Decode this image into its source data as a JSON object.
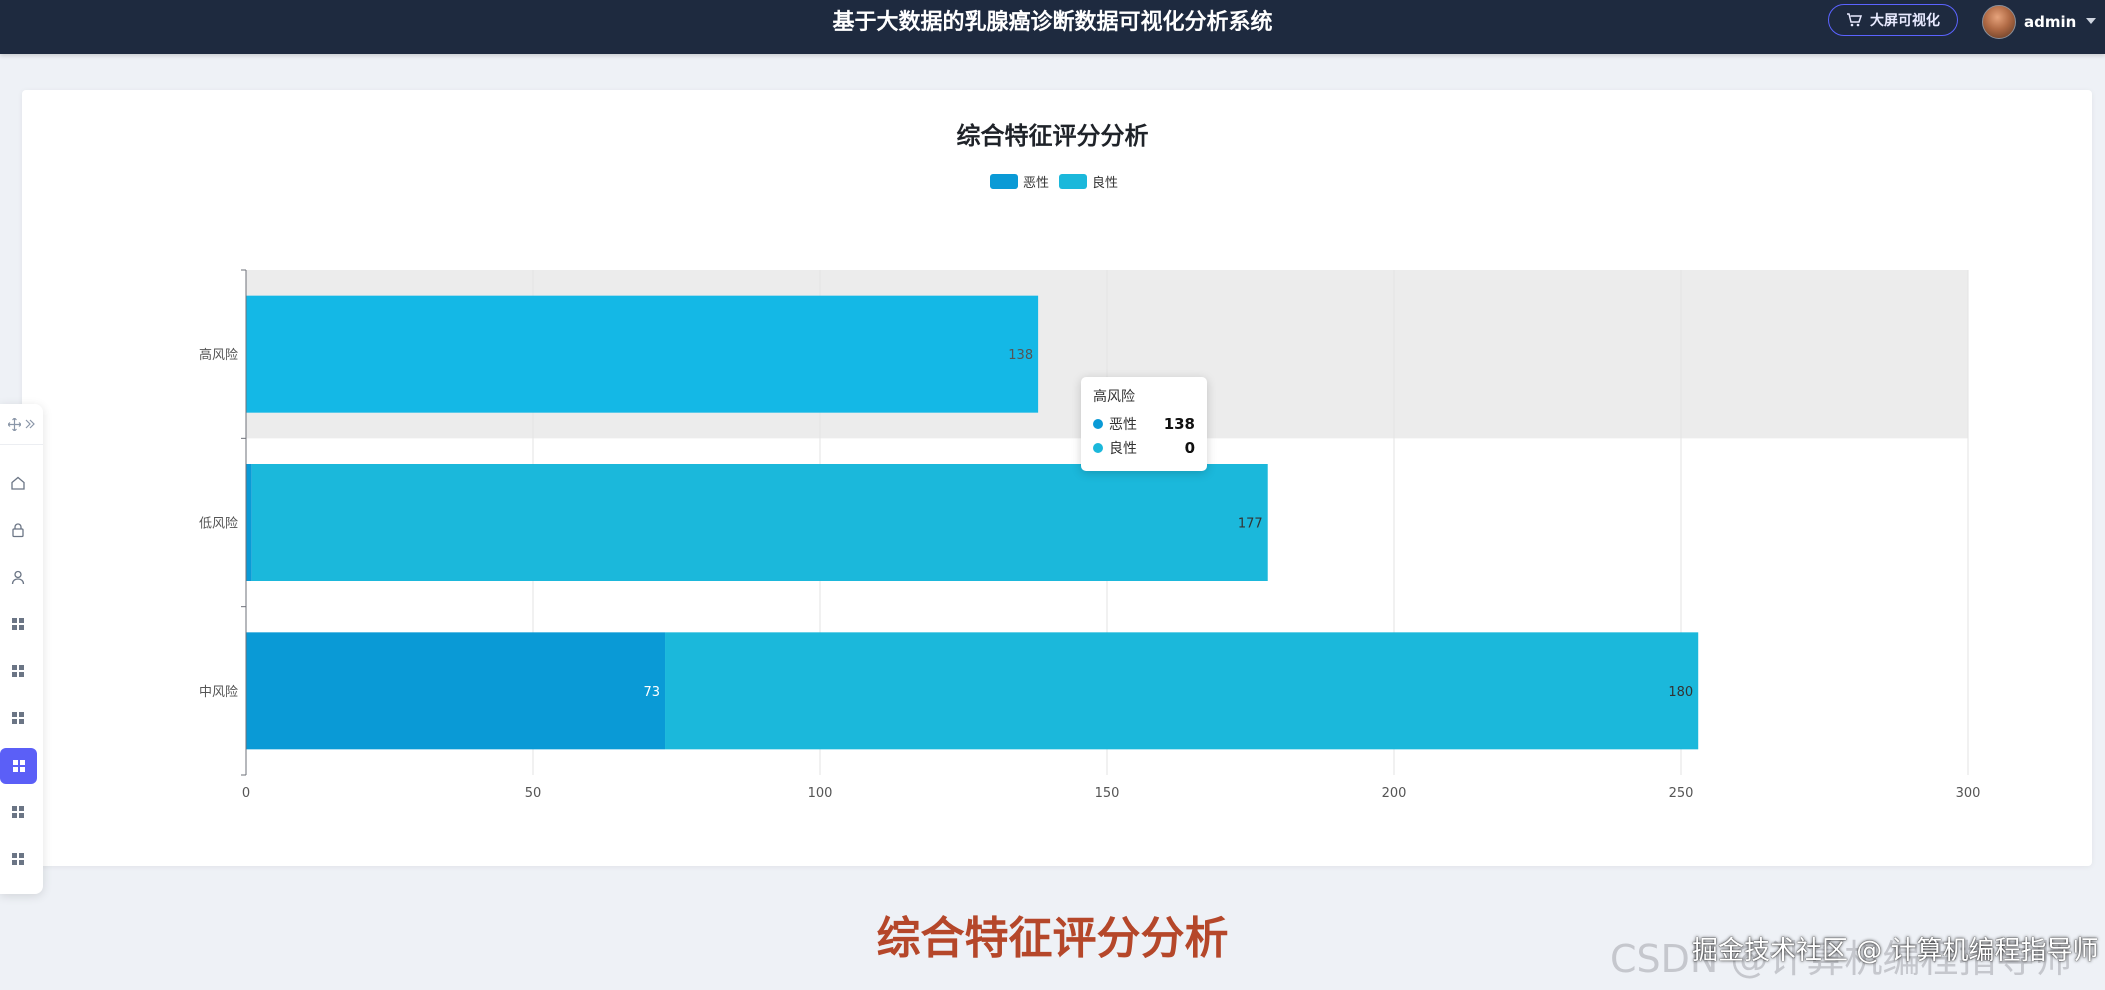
{
  "header": {
    "title": "基于大数据的乳腺癌诊断数据可视化分析系统",
    "screen_button_label": "大屏可视化",
    "user_name": "admin"
  },
  "chart_title": "综合特征评分分析",
  "legend": [
    {
      "name": "恶性",
      "color": "#0a9ad6"
    },
    {
      "name": "良性",
      "color": "#1bb8db"
    }
  ],
  "chart_data": {
    "type": "bar",
    "orientation": "horizontal",
    "stacked": true,
    "title": "综合特征评分分析",
    "categories": [
      "高风险",
      "低风险",
      "中风险"
    ],
    "series": [
      {
        "name": "恶性",
        "values": [
          138,
          1,
          73
        ],
        "color": "#0a9ad6"
      },
      {
        "name": "良性",
        "values": [
          0,
          177,
          180
        ],
        "color": "#1bb8db"
      }
    ],
    "xlim": [
      0,
      300
    ],
    "xticks": [
      0,
      50,
      100,
      150,
      200,
      250,
      300
    ],
    "highlighted_category": "高风险",
    "highlight_bar_color": "#14b8e6",
    "grid": true
  },
  "tooltip": {
    "title": "高风险",
    "rows": [
      {
        "name": "恶性",
        "value": "138",
        "color": "#0a9ad6"
      },
      {
        "name": "良性",
        "value": "0",
        "color": "#1bb8db"
      }
    ]
  },
  "sidebar": {
    "items": [
      {
        "icon": "home-icon"
      },
      {
        "icon": "lock-icon"
      },
      {
        "icon": "user-icon"
      },
      {
        "icon": "grid-icon"
      },
      {
        "icon": "grid-icon"
      },
      {
        "icon": "grid-icon"
      },
      {
        "icon": "grid-icon",
        "active": true
      },
      {
        "icon": "grid-icon"
      },
      {
        "icon": "grid-icon"
      }
    ]
  },
  "caption": "综合特征评分分析",
  "watermark": {
    "faint": "CSDN @计算机编程指导师",
    "main": "掘金技术社区 @ 计算机编程指导师"
  }
}
